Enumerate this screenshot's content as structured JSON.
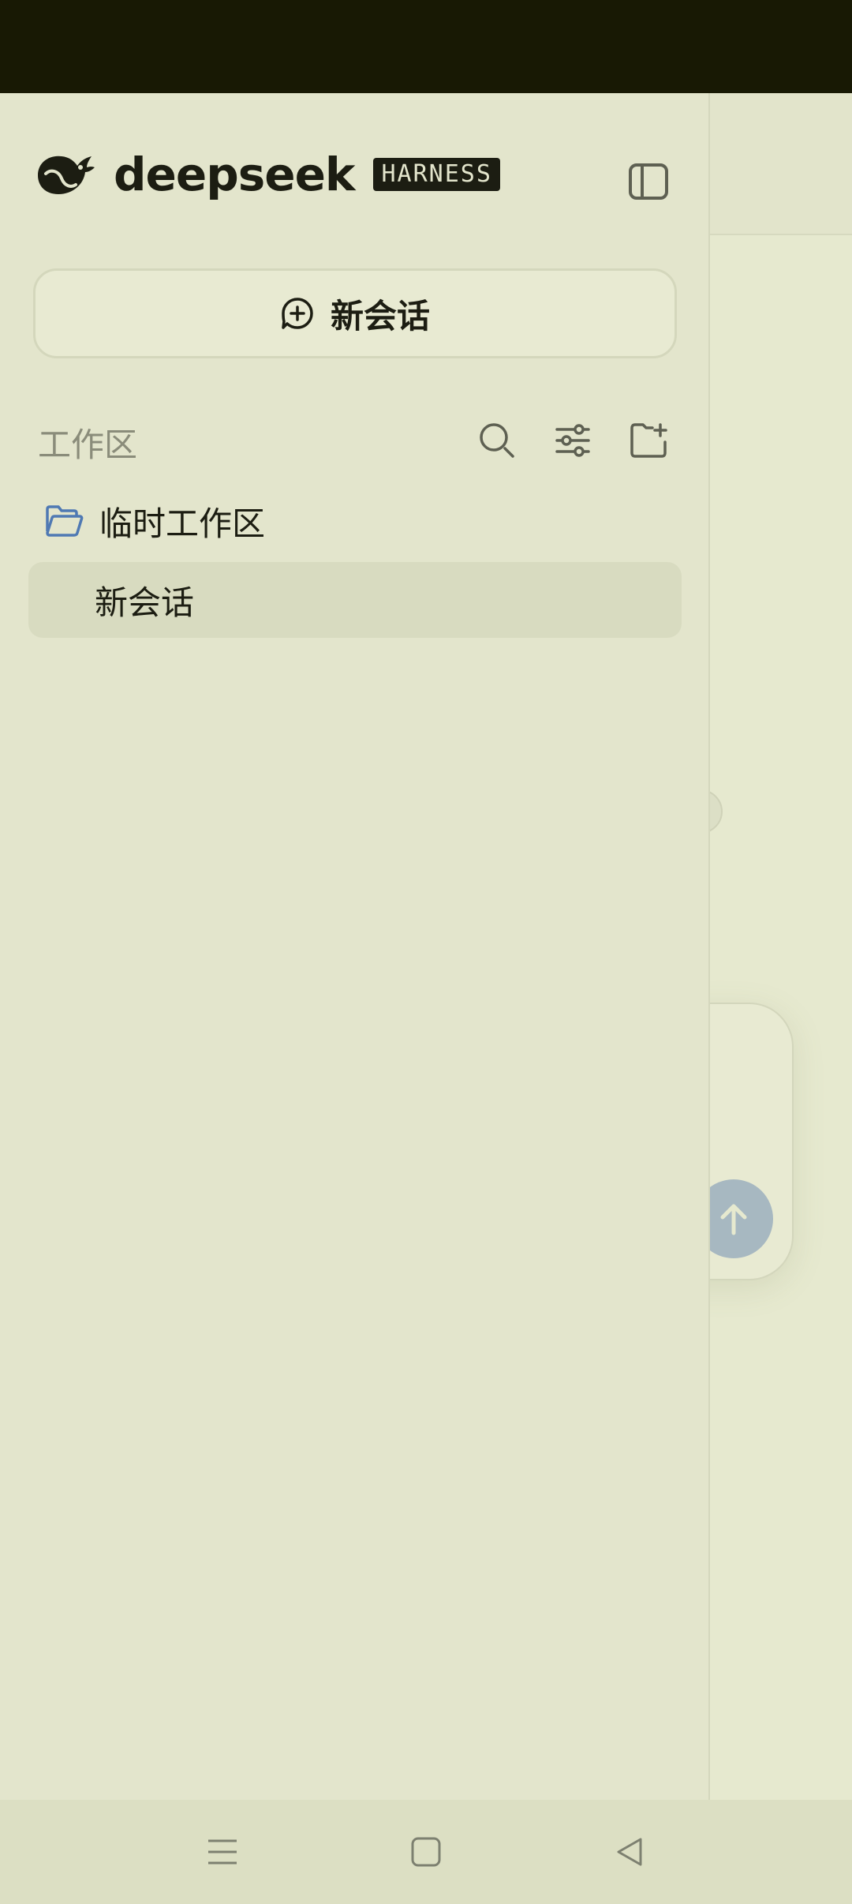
{
  "app": {
    "brand_name": "deepseek",
    "brand_badge": "HARNESS"
  },
  "sidebar": {
    "new_chat_label": "新会话",
    "section_title": "工作区",
    "workspaces": [
      {
        "name": "临时工作区",
        "chats": [
          {
            "title": "新会话",
            "selected": true
          }
        ]
      }
    ]
  },
  "icons": {
    "logo": "deepseek-whale-icon",
    "collapse": "sidebar-toggle-icon",
    "new_chat": "add-chat-icon",
    "search": "search-icon",
    "filter": "sliders-icon",
    "new_workspace": "folder-plus-icon",
    "folder": "folder-open-icon",
    "send": "arrow-up-icon",
    "nav_menu": "menu-icon",
    "nav_home": "home-icon",
    "nav_back": "back-icon"
  },
  "colors": {
    "background": "#e3e5cc",
    "text": "#1c1d12",
    "muted": "#8a8c7a",
    "selected_item": "#d8dbc0",
    "folder_accent": "#4f79b3",
    "send_button": "#a7b8c1",
    "status_bar": "#181904"
  }
}
